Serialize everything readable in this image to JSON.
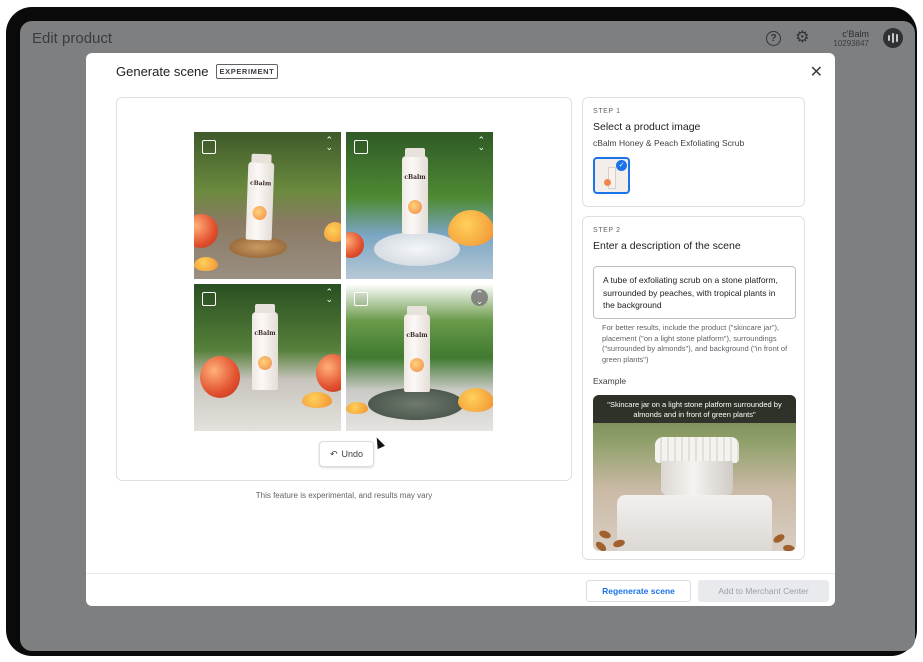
{
  "app": {
    "title": "Edit product",
    "account_name": "c'Balm",
    "account_id": "10293847"
  },
  "modal": {
    "title": "Generate scene",
    "badge": "EXPERIMENT",
    "undo_label": "Undo",
    "disclaimer": "This feature is experimental, and results may vary",
    "tiles": [
      {
        "brand": "cBalm"
      },
      {
        "brand": "cBalm"
      },
      {
        "brand": "cBalm"
      },
      {
        "brand": "cBalm"
      }
    ]
  },
  "step1": {
    "label": "STEP 1",
    "heading": "Select a product image",
    "product_name": "cBalm Honey & Peach Exfoliating Scrub"
  },
  "step2": {
    "label": "STEP 2",
    "heading": "Enter a description of the scene",
    "description": "A tube of exfoliating scrub on a stone platform, surrounded by peaches, with tropical plants in the background",
    "hint": "For better results, include the product (\"skincare jar\"), placement (\"on a light stone platform\"), surroundings (\"surrounded by almonds\"), and background (\"in front of green plants\")",
    "example_label": "Example",
    "example_caption": "\"Skincare jar on a light stone platform surrounded by almonds and in front of green plants\""
  },
  "footer": {
    "regenerate_label": "Regenerate scene",
    "add_label": "Add to Merchant Center"
  },
  "icons": {
    "help": "help-icon",
    "settings": "gear-icon",
    "close": "close-icon",
    "undo": "undo-icon",
    "expand": "expand-icon",
    "check": "check-icon"
  },
  "colors": {
    "accent": "#1a73e8",
    "backdrop": "#7d7f80"
  }
}
